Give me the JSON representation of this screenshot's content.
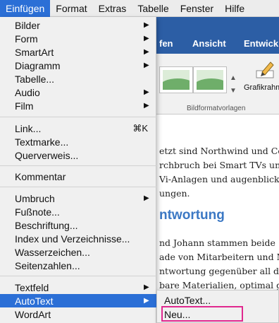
{
  "menubar": {
    "items": [
      "Einfügen",
      "Format",
      "Extras",
      "Tabelle",
      "Fenster",
      "Hilfe"
    ]
  },
  "ribbon": {
    "tabs": [
      "fen",
      "Ansicht",
      "Entwick"
    ],
    "grafik_label": "Grafikrahm",
    "group_label": "Bildformatvorlagen"
  },
  "document": {
    "lines_top": [
      "etzt sind Northwind und Con",
      "rchbruch bei Smart TVs und",
      "Vi-Anlagen und augenblickli",
      "ungen."
    ],
    "heading": "ntwortung",
    "lines_bottom": [
      "nd Johann stammen beide",
      "ade von Mitarbeitern und Mi",
      "ntwortung gegenüber all die",
      "bare Materialien, optimal ge"
    ]
  },
  "menu": {
    "group1": [
      {
        "label": "Bilder",
        "submenu": true
      },
      {
        "label": "Form",
        "submenu": true
      },
      {
        "label": "SmartArt",
        "submenu": true
      },
      {
        "label": "Diagramm",
        "submenu": true
      },
      {
        "label": "Tabelle...",
        "submenu": false
      },
      {
        "label": "Audio",
        "submenu": true
      },
      {
        "label": "Film",
        "submenu": true
      }
    ],
    "group2": [
      {
        "label": "Link...",
        "shortcut": "⌘K"
      },
      {
        "label": "Textmarke..."
      },
      {
        "label": "Querverweis..."
      }
    ],
    "group3": [
      {
        "label": "Kommentar"
      }
    ],
    "group4": [
      {
        "label": "Umbruch",
        "submenu": true
      },
      {
        "label": "Fußnote..."
      },
      {
        "label": "Beschriftung..."
      },
      {
        "label": "Index und Verzeichnisse..."
      },
      {
        "label": "Wasserzeichen..."
      },
      {
        "label": "Seitenzahlen..."
      }
    ],
    "group5": [
      {
        "label": "Textfeld",
        "submenu": true
      },
      {
        "label": "AutoText",
        "submenu": true,
        "highlighted": true
      },
      {
        "label": "WordArt"
      }
    ]
  },
  "submenu": {
    "items": [
      "AutoText...",
      "Neu..."
    ]
  },
  "colors": {
    "accent": "#2b6fd6",
    "highlight_box": "#e0298f",
    "ribbon": "#2c5ea5",
    "heading": "#3b78c4"
  }
}
